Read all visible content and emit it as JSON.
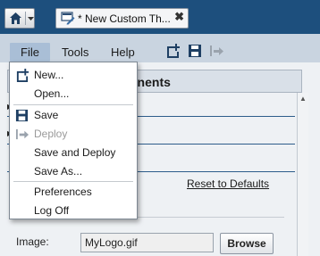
{
  "colors": {
    "topbar": "#1d4f7d",
    "menubar": "#c9d4e0",
    "menu_active": "#a9bed6",
    "accent_rule": "#2d5c8a",
    "disabled_text": "#9a9a9a"
  },
  "topbar": {
    "home_icon": "home-icon",
    "dropdown_icon": "chevron-down-icon",
    "tab": {
      "icon": "document-edit-icon",
      "title": "* New Custom Th...",
      "close": "✖"
    }
  },
  "menubar": {
    "items": [
      {
        "label": "File"
      },
      {
        "label": "Tools"
      },
      {
        "label": "Help"
      }
    ],
    "toolbar_icons": [
      "new-icon",
      "save-icon",
      "deploy-icon"
    ]
  },
  "panel": {
    "title_partial": "onents"
  },
  "file_menu": {
    "items": [
      {
        "label": "New...",
        "icon": "new-icon",
        "enabled": true
      },
      {
        "label": "Open...",
        "icon": "",
        "enabled": true
      },
      {
        "label": "Save",
        "icon": "save-icon",
        "enabled": true
      },
      {
        "label": "Deploy",
        "icon": "deploy-icon",
        "enabled": false
      },
      {
        "label": "Save and Deploy",
        "icon": "",
        "enabled": true
      },
      {
        "label": "Save As...",
        "icon": "",
        "enabled": true
      },
      {
        "label": "Preferences",
        "icon": "",
        "enabled": true
      },
      {
        "label": "Log Off",
        "icon": "",
        "enabled": true
      }
    ]
  },
  "form": {
    "reset_label": "Reset to Defaults",
    "image_label": "Image:",
    "image_value": "MyLogo.gif",
    "browse_label": "Browse"
  }
}
